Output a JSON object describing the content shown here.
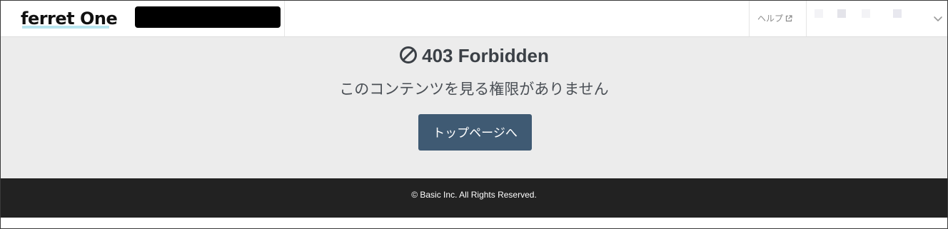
{
  "header": {
    "logo_text": "ferret One",
    "help_label": "ヘルプ",
    "help_icon": "external-link-icon",
    "user_menu_icon": "chevron-down-icon"
  },
  "main": {
    "title_icon": "ban-icon",
    "title": "403 Forbidden",
    "message": "このコンテンツを見る権限がありません",
    "button_label": "トップページへ"
  },
  "footer": {
    "copyright": "© Basic Inc. All Rights Reserved."
  },
  "colors": {
    "header_bg": "#ffffff",
    "main_bg": "#ececec",
    "button_bg": "#3f5a73",
    "footer_bg": "#222222",
    "title_text": "#3b4046"
  }
}
